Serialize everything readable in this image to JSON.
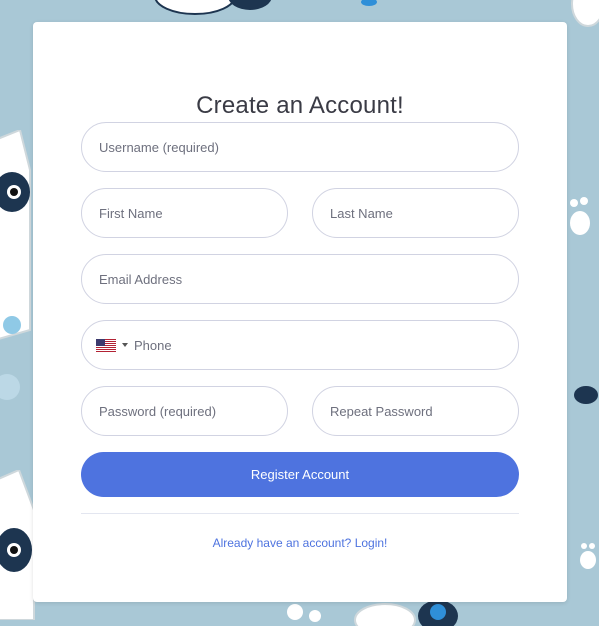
{
  "page": {
    "title": "Create an Account!"
  },
  "form": {
    "username_placeholder": "Username (required)",
    "first_name_placeholder": "First Name",
    "last_name_placeholder": "Last Name",
    "email_placeholder": "Email Address",
    "phone_placeholder": "Phone",
    "phone_country_icon": "us-flag-icon",
    "password_placeholder": "Password (required)",
    "repeat_password_placeholder": "Repeat Password",
    "register_label": "Register Account",
    "login_link": "Already have an account? Login!"
  },
  "colors": {
    "background": "#a9c8d6",
    "accent": "#4e73df",
    "card": "#ffffff"
  }
}
